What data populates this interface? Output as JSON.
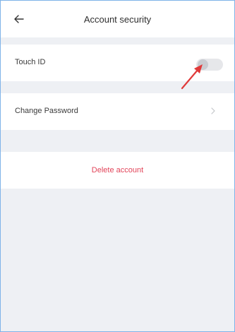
{
  "header": {
    "title": "Account security",
    "back_icon": "arrow-left-icon"
  },
  "settings": {
    "touch_id": {
      "label": "Touch ID",
      "enabled": false
    },
    "change_password": {
      "label": "Change Password",
      "icon": "chevron-right-icon"
    },
    "delete_account": {
      "label": "Delete account"
    }
  },
  "colors": {
    "background": "#eef0f4",
    "danger": "#e2455a",
    "annotation_arrow": "#e03a3a",
    "frame_border": "#7fb3e8"
  }
}
